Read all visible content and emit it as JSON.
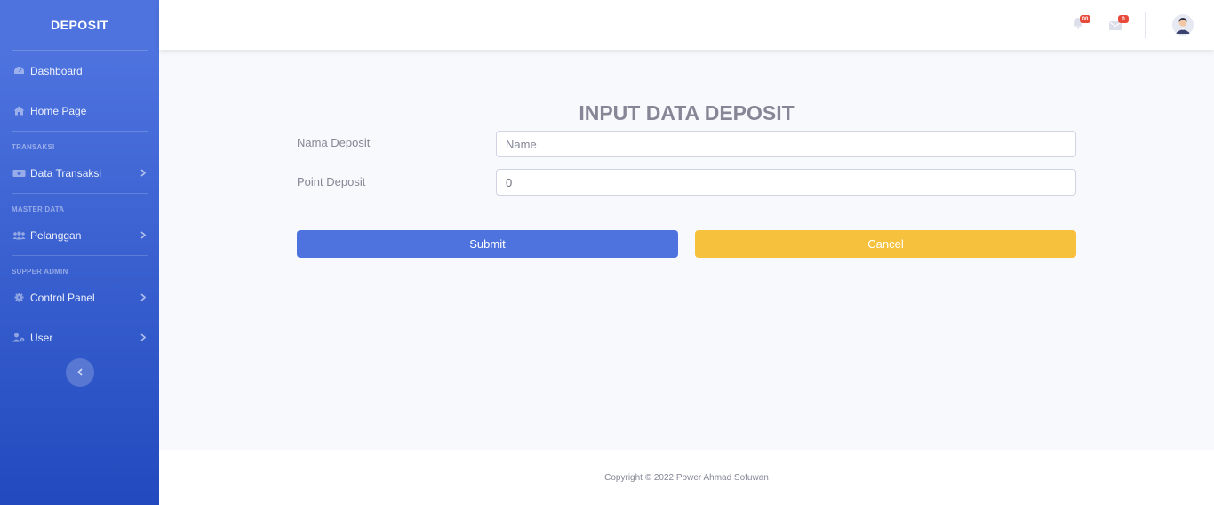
{
  "sidebar": {
    "brand": "DEPOSIT",
    "items": [
      {
        "label": "Dashboard",
        "icon": "tachometer-icon"
      },
      {
        "label": "Home Page",
        "icon": "home-icon"
      }
    ],
    "headings": [
      "TRANSAKSI",
      "MASTER DATA",
      "SUPPER ADMIN"
    ],
    "groups": [
      {
        "label": "Data Transaksi",
        "icon": "money-icon"
      },
      {
        "label": "Pelanggan",
        "icon": "users-icon"
      },
      {
        "label": "Control Panel",
        "icon": "cog-icon"
      },
      {
        "label": "User",
        "icon": "user-cog-icon"
      }
    ],
    "toggle_icon": "chevron-left-icon",
    "gradient_from": "#4e73df",
    "gradient_to": "#224abe"
  },
  "topbar": {
    "alerts_count": "00",
    "messages_count": "0"
  },
  "form": {
    "title": "INPUT DATA DEPOSIT",
    "nama_label": "Nama Deposit",
    "nama_placeholder": "Name",
    "point_label": "Point Deposit",
    "point_value": "0",
    "submit_label": "Submit",
    "cancel_label": "Cancel"
  },
  "colors": {
    "primary": "#4e73df",
    "warning": "#f6c23e",
    "danger": "#e74a3b"
  },
  "footer": {
    "copyright": "Copyright © 2022 Power Ahmad Sofuwan"
  }
}
